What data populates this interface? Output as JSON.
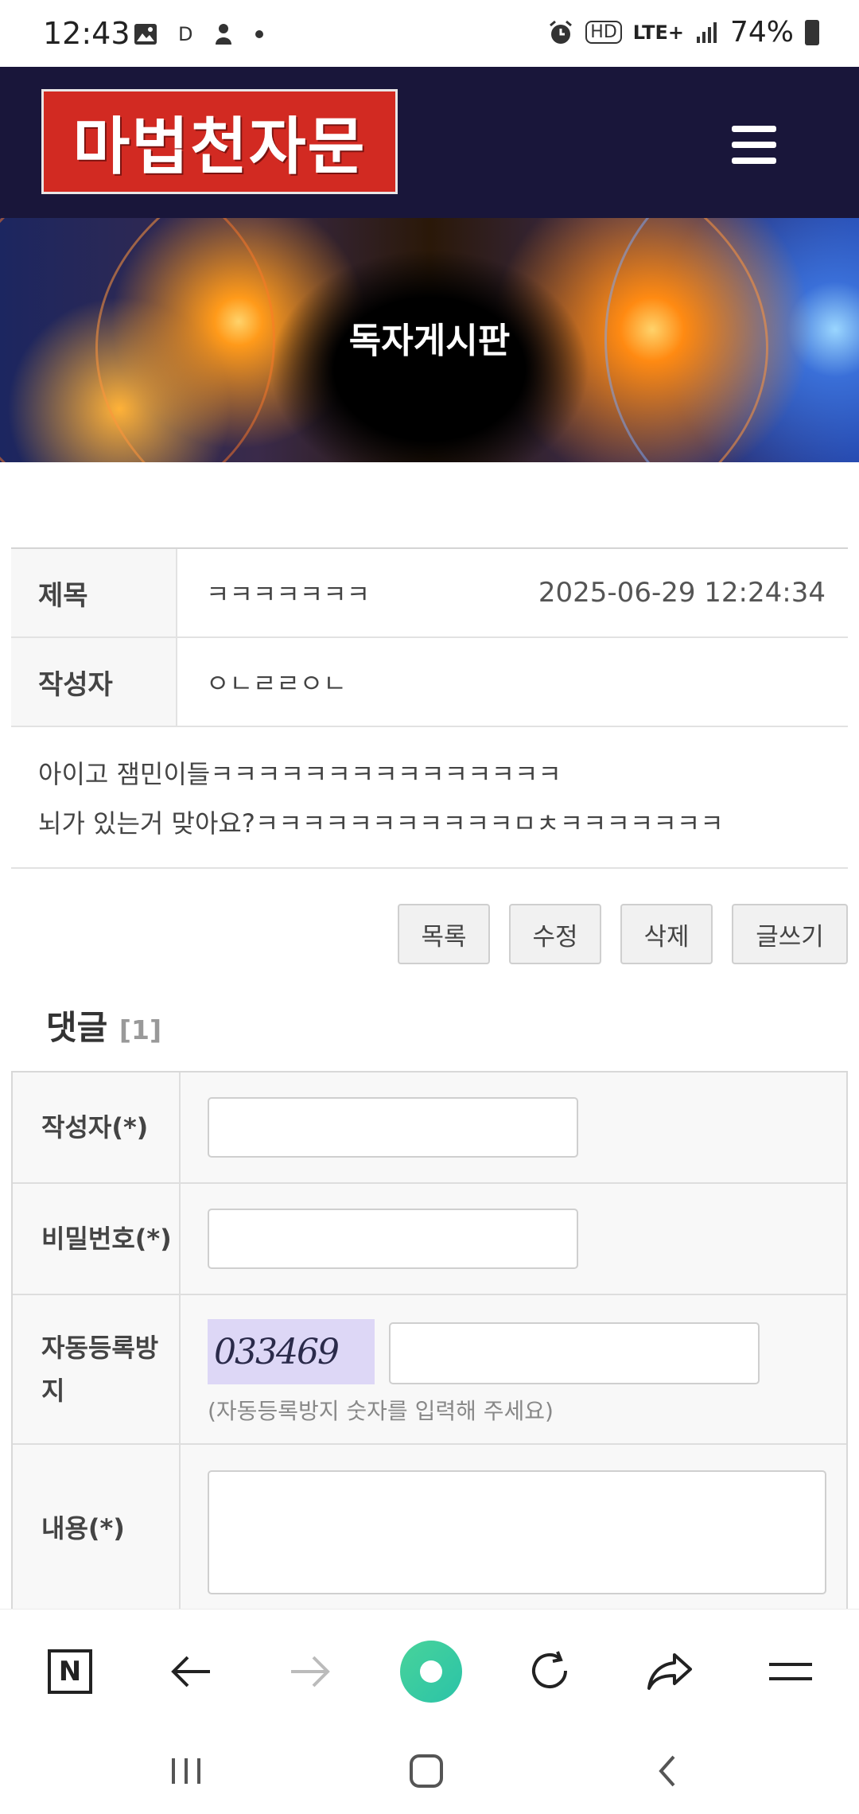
{
  "status_bar": {
    "time": "12:43",
    "left_icons": [
      "image-icon",
      "d-notification-icon",
      "app-notification-icon",
      "dot-icon"
    ],
    "d_label": "D",
    "hd_label": "HD",
    "network": "LTE+",
    "battery": "74%"
  },
  "header": {
    "logo_text": "마법천자문",
    "menu_icon": "hamburger-menu-icon"
  },
  "banner": {
    "title": "독자게시판"
  },
  "post": {
    "title_label": "제목",
    "title_value": "ㅋㅋㅋㅋㅋㅋㅋ",
    "date": "2025-06-29 12:24:34",
    "author_label": "작성자",
    "author_value": "ㅇㄴㄹㄹㅇㄴ",
    "content_lines": [
      "아이고 잼민이들ㅋㅋㅋㅋㅋㅋㅋㅋㅋㅋㅋㅋㅋㅋㅋ",
      "뇌가 있는거 맞아요?ㅋㅋㅋㅋㅋㅋㅋㅋㅋㅋㅋㅁㅊㅋㅋㅋㅋㅋㅋㅋ"
    ]
  },
  "actions": {
    "list": "목록",
    "edit": "수정",
    "delete": "삭제",
    "write": "글쓰기"
  },
  "comments": {
    "title": "댓글",
    "count": "[1]"
  },
  "comment_form": {
    "author_label": "작성자(*)",
    "password_label": "비밀번호(*)",
    "captcha_label": "자동등록방지",
    "captcha_code": "033469",
    "captcha_hint": "(자동등록방지 숫자를 입력해 주세요)",
    "content_label": "내용(*)"
  },
  "browser_bar": {
    "home_label": "N",
    "icons": [
      "naver-home-icon",
      "back-arrow-icon",
      "forward-arrow-icon",
      "green-dot-icon",
      "refresh-icon",
      "share-icon",
      "menu-icon"
    ]
  },
  "system_nav": {
    "icons": [
      "recent-apps-icon",
      "home-icon",
      "back-icon"
    ]
  }
}
